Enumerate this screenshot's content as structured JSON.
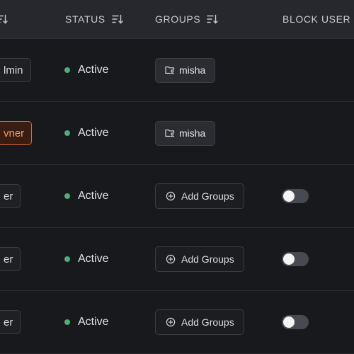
{
  "table": {
    "columns": [
      {
        "label": ""
      },
      {
        "label": "STATUS"
      },
      {
        "label": "GROUPS"
      },
      {
        "label": "BLOCK USER"
      }
    ],
    "rows": [
      {
        "role": "Admin",
        "role_visible": "lmin",
        "role_style": "default",
        "status": "Active",
        "group": {
          "type": "folder",
          "label": "misha"
        },
        "block_toggle_shown": false
      },
      {
        "role": "Owner",
        "role_visible": "vner",
        "role_style": "owner",
        "status": "Active",
        "group": {
          "type": "folder",
          "label": "misha"
        },
        "block_toggle_shown": false
      },
      {
        "role": "User",
        "role_visible": "er",
        "role_style": "default",
        "status": "Active",
        "group": {
          "type": "add",
          "label": "Add Groups"
        },
        "block_toggle_shown": true,
        "blocked": false
      },
      {
        "role": "User",
        "role_visible": "er",
        "role_style": "default",
        "status": "Active",
        "group": {
          "type": "add",
          "label": "Add Groups"
        },
        "block_toggle_shown": true,
        "blocked": false
      },
      {
        "role": "User",
        "role_visible": "er",
        "role_style": "default",
        "status": "Active",
        "group": {
          "type": "add",
          "label": "Add Groups"
        },
        "block_toggle_shown": true,
        "blocked": false
      }
    ]
  },
  "colors": {
    "status_active": "#4caf73",
    "owner_accent": "#d86a31",
    "header_bg": "#26282d",
    "page_bg": "#18191c"
  },
  "icons": {
    "sort": "sort-descending-icon",
    "folder": "folder-user-icon",
    "add": "plus-circle-icon"
  }
}
